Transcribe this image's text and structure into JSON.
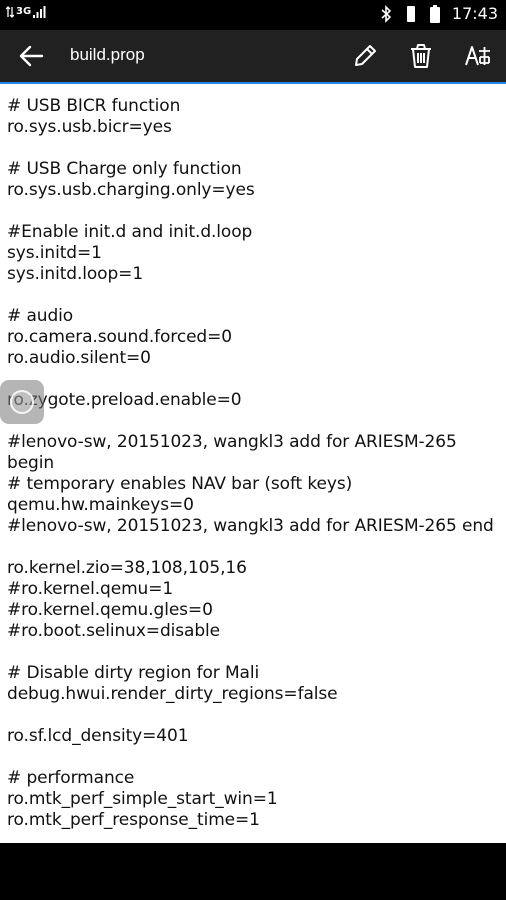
{
  "status_bar": {
    "network": "3G",
    "time": "17:43"
  },
  "app_bar": {
    "title": "build.prop",
    "icons": {
      "back": "arrow-back-icon",
      "edit": "pencil-icon",
      "delete": "trash-icon",
      "font": "font-size-icon"
    },
    "accent_color": "#1e88e5"
  },
  "content": {
    "lines": [
      "# USB BICR function",
      "ro.sys.usb.bicr=yes",
      "",
      "# USB Charge only function",
      "ro.sys.usb.charging.only=yes",
      "",
      "#Enable init.d and init.d.loop",
      "sys.initd=1",
      "sys.initd.loop=1",
      "",
      "# audio",
      "ro.camera.sound.forced=0",
      "ro.audio.silent=0",
      "",
      "ro.zygote.preload.enable=0",
      "",
      "#lenovo-sw, 20151023, wangkl3 add for ARIESM-265",
      "begin",
      "# temporary enables NAV bar (soft keys)",
      "qemu.hw.mainkeys=0",
      "#lenovo-sw, 20151023, wangkl3 add for ARIESM-265 end",
      "",
      "ro.kernel.zio=38,108,105,16",
      "#ro.kernel.qemu=1",
      "#ro.kernel.qemu.gles=0",
      "#ro.boot.selinux=disable",
      "",
      "# Disable dirty region for Mali",
      "debug.hwui.render_dirty_regions=false",
      "",
      "ro.sf.lcd_density=401",
      "",
      "# performance",
      "ro.mtk_perf_simple_start_win=1",
      "ro.mtk_perf_response_time=1"
    ]
  }
}
